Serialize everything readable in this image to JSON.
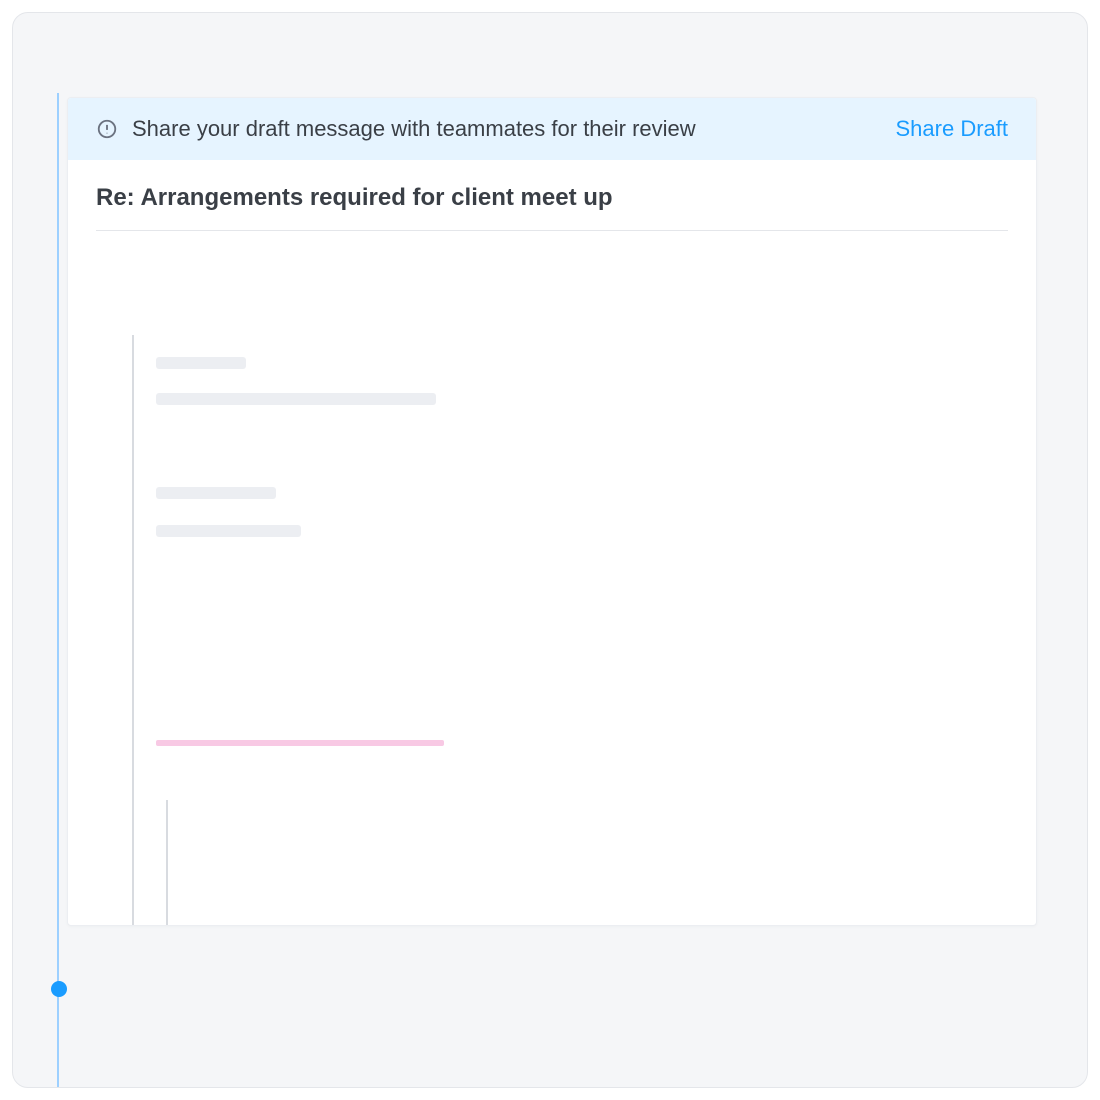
{
  "banner": {
    "message": "Share your draft message with teammates for their review",
    "action_label": "Share Draft",
    "icon": "alert-circle-icon"
  },
  "email": {
    "subject": "Re: Arrangements required for client meet up"
  },
  "colors": {
    "accent": "#1a9cff",
    "banner_bg": "#e6f4ff",
    "placeholder": "#eceef2",
    "pink_highlight": "#f8c9e4"
  }
}
